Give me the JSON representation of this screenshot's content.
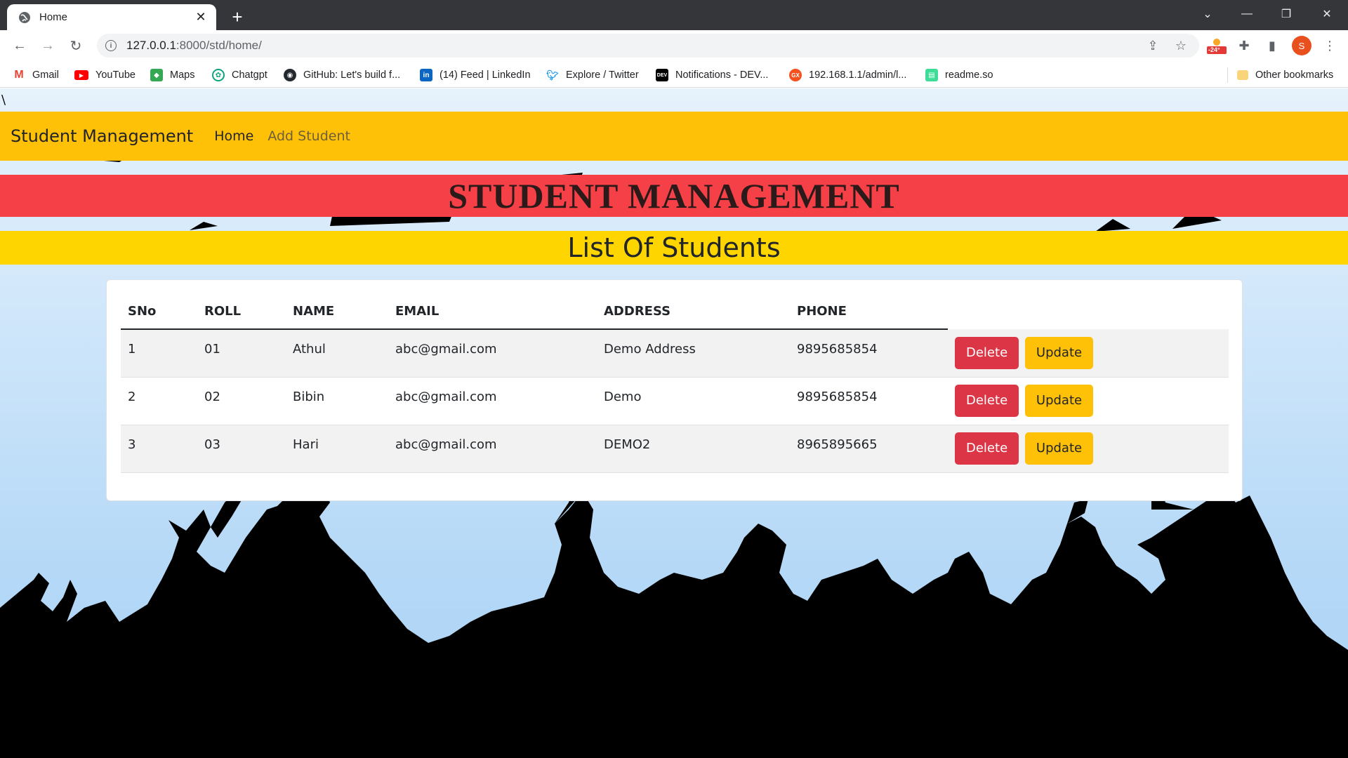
{
  "browser": {
    "tab_title": "Home",
    "url_host": "127.0.0.1",
    "url_path": ":8000/std/home/",
    "profile_initial": "S",
    "extension_badge": "-24°"
  },
  "bookmarks": [
    {
      "label": "Gmail",
      "icon": "gmail-icon",
      "color": "#ea4335"
    },
    {
      "label": "YouTube",
      "icon": "youtube-icon",
      "color": "#ff0000"
    },
    {
      "label": "Maps",
      "icon": "maps-icon",
      "color": "#34a853"
    },
    {
      "label": "Chatgpt",
      "icon": "chatgpt-icon",
      "color": "#10a37f"
    },
    {
      "label": "GitHub: Let's build f...",
      "icon": "github-icon",
      "color": "#24292f"
    },
    {
      "label": "(14) Feed | LinkedIn",
      "icon": "linkedin-icon",
      "color": "#0a66c2"
    },
    {
      "label": "Explore / Twitter",
      "icon": "twitter-icon",
      "color": "#1d9bf0"
    },
    {
      "label": "Notifications - DEV...",
      "icon": "dev-icon",
      "color": "#000000"
    },
    {
      "label": "192.168.1.1/admin/l...",
      "icon": "router-icon",
      "color": "#f4511e"
    },
    {
      "label": "readme.so",
      "icon": "readme-icon",
      "color": "#3ddc97"
    }
  ],
  "other_bookmarks": "Other bookmarks",
  "page": {
    "stray_char": "\\",
    "brand": "Student Management",
    "nav": {
      "home": "Home",
      "add": "Add Student"
    },
    "heading": "STUDENT MANAGEMENT",
    "subheading": "List Of Students",
    "colors": {
      "navbar": "#ffc107",
      "banner_red": "#f44046",
      "banner_yellow": "#ffd500",
      "delete": "#dc3545",
      "update": "#ffc107"
    }
  },
  "table": {
    "headers": [
      "SNo",
      "ROLL",
      "NAME",
      "EMAIL",
      "ADDRESS",
      "PHONE"
    ],
    "rows": [
      {
        "sno": "1",
        "roll": "01",
        "name": "Athul",
        "email": "abc@gmail.com",
        "address": "Demo Address",
        "phone": "9895685854",
        "delete": "Delete",
        "update": "Update"
      },
      {
        "sno": "2",
        "roll": "02",
        "name": "Bibin",
        "email": "abc@gmail.com",
        "address": "Demo",
        "phone": "9895685854",
        "delete": "Delete",
        "update": "Update"
      },
      {
        "sno": "3",
        "roll": "03",
        "name": "Hari",
        "email": "abc@gmail.com",
        "address": "DEMO2",
        "phone": "8965895665",
        "delete": "Delete",
        "update": "Update"
      }
    ]
  }
}
